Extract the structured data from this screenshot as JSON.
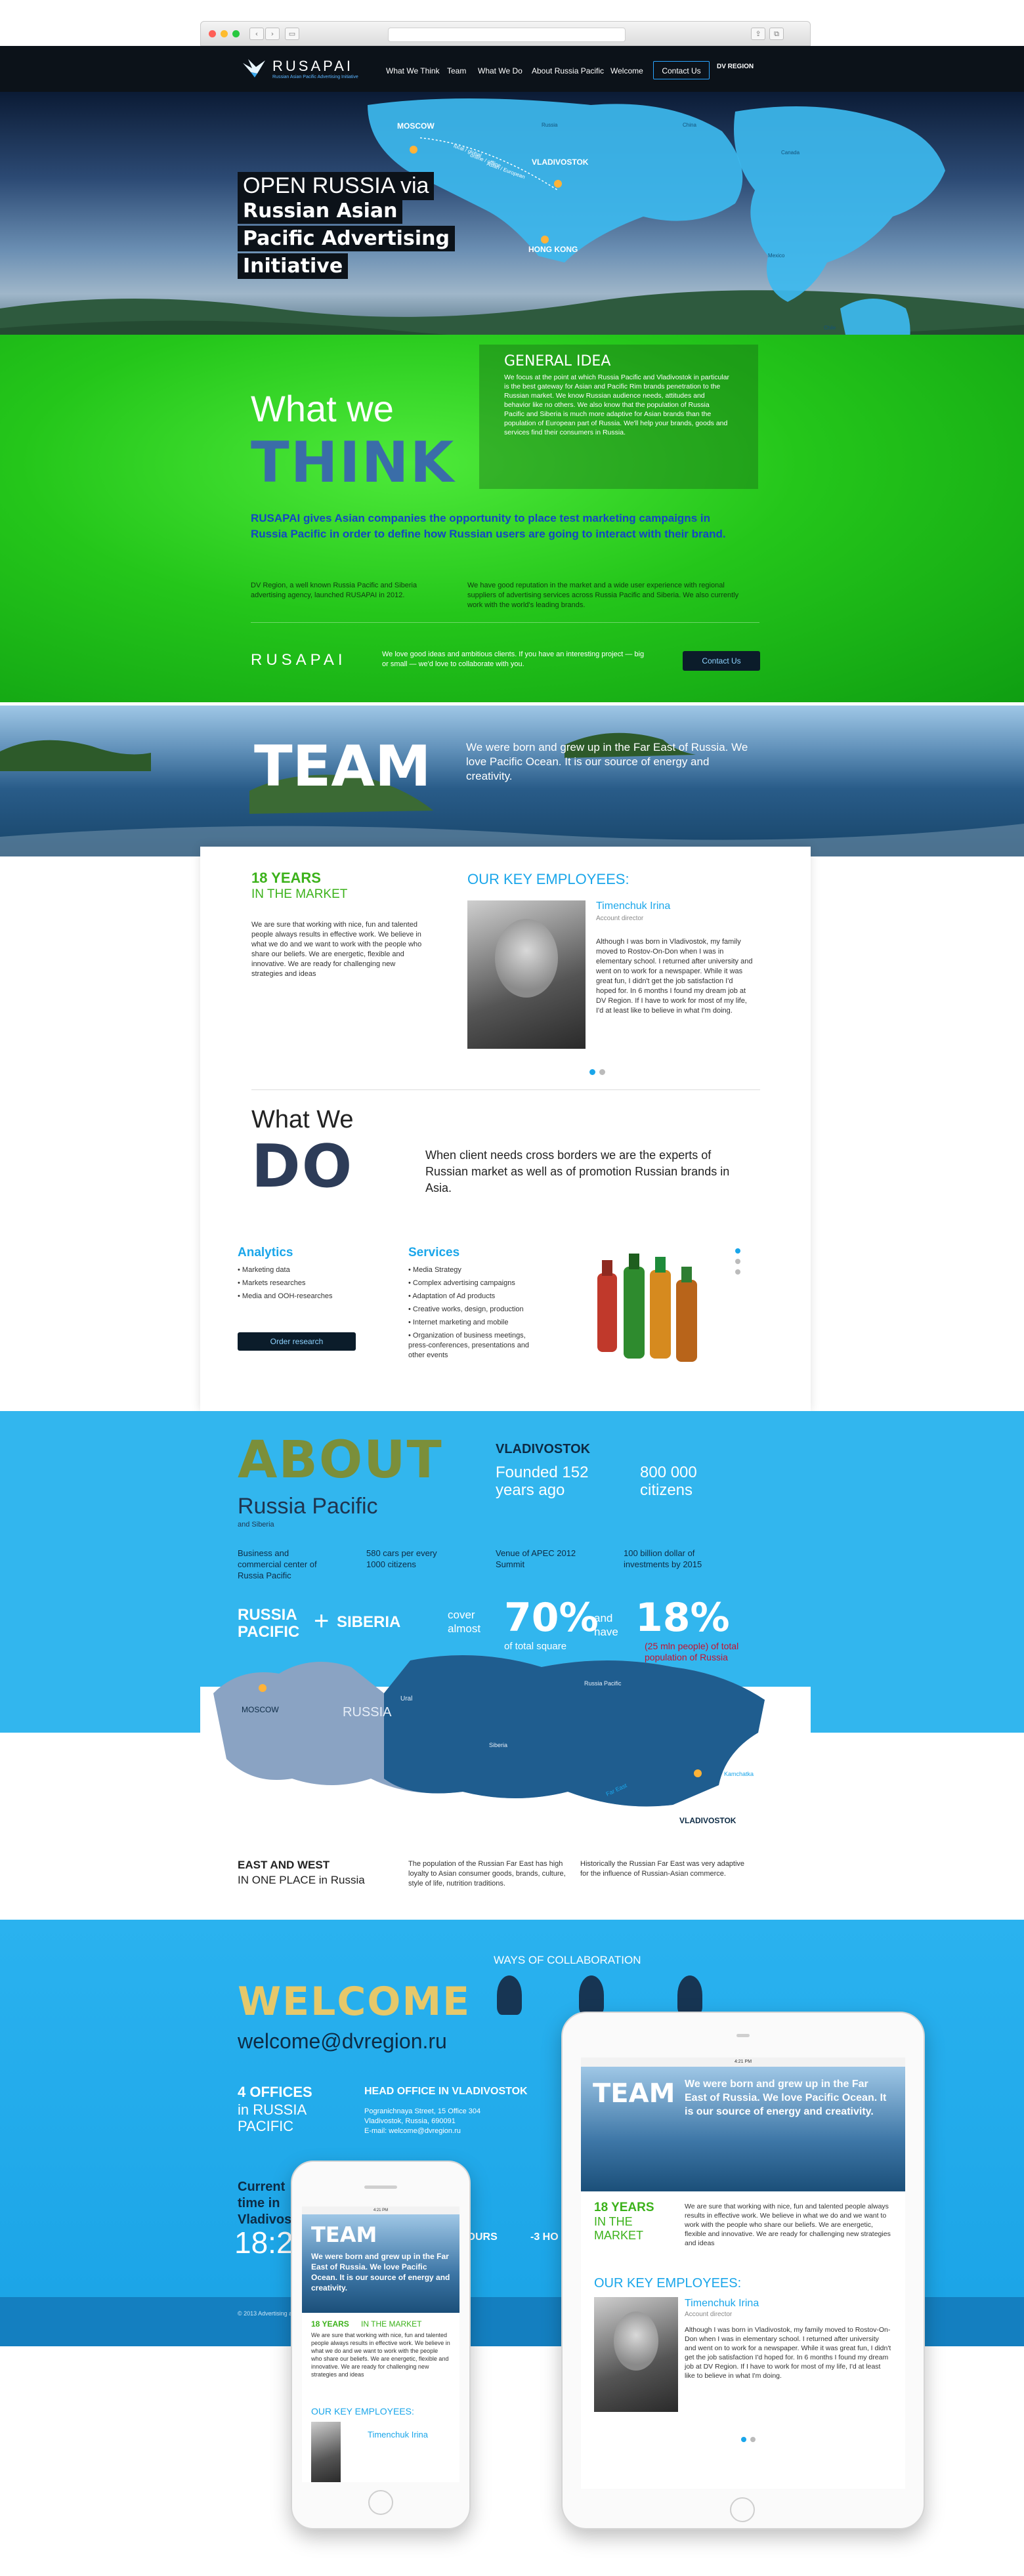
{
  "nav": {
    "logo": "RUSAPAI",
    "logo_sub": "Russian Asian Pacific Advertising Initiative",
    "items": [
      "What We Think",
      "Team",
      "What We Do",
      "About Russia Pacific",
      "Welcome"
    ],
    "contact": "Contact Us",
    "partner_logo": "DV REGION"
  },
  "hero": {
    "line1": "OPEN RUSSIA via",
    "line2": "Russian Asian",
    "line3": "Pacific Advertising",
    "line4": "Initiative",
    "cities": [
      "MOSCOW",
      "VLADIVOSTOK",
      "HONG KONG"
    ],
    "map_labels": [
      "Russia",
      "China",
      "Canada",
      "Mexico",
      "Chile"
    ],
    "route_labels": [
      "local / global",
      "online / offline",
      "Asian / European"
    ]
  },
  "think": {
    "what_we": "What we",
    "think": "THINK",
    "general_title": "GENERAL IDEA",
    "general_text": "We focus at the point at which Russia Pacific and Vladivostok in particular is the best gateway for Asian and Pacific Rim brands penetration to the Russian market. We know Russian audience needs, attitudes and behavior like no others. We also know that the population of Russia Pacific and Siberia is much more adaptive for Asian brands than the population of European part of Russia. We'll help your brands, goods and services find their consumers in Russia.",
    "lead": "RUSAPAI gives Asian companies the opportunity to place test marketing campaigns in Russia Pacific in order to define how Russian users are going to interact with their brand.",
    "col1": "DV Region, a well known Russia Pacific and Siberia advertising agency, launched RUSAPAI in 2012.",
    "col2": "We have good reputation in the market and a wide user experience with regional suppliers of advertising services across Russia Pacific and Siberia. We also currently work with the world's leading brands.",
    "band_logo": "RUSAPAI",
    "band_text": "We love good ideas and ambitious clients. If you have an interesting project — big or small — we'd love to collaborate with you.",
    "band_btn": "Contact Us"
  },
  "team": {
    "title": "TEAM",
    "tagline": "We were born and grew up in the Far East of Russia. We love Pacific Ocean. It is our source of energy and creativity.",
    "years_title": "18 YEARS",
    "years_sub": "IN THE MARKET",
    "years_text": "We are sure that working with nice, fun and talented people always results in effective work. We believe in what we do and we want to work with the people who share our beliefs. We are energetic, flexible and innovative. We are ready for challenging new strategies and ideas",
    "key_title": "OUR KEY EMPLOYEES:",
    "emp_name": "Timenchuk Irina",
    "emp_role": "Account director",
    "emp_text": "Although I was born in Vladivostok, my family moved to Rostov-On-Don when I was in elementary school. I returned after university and went on to work for a newspaper. While it was great fun, I didn't get the job satisfaction I'd hoped for. In 6 months I found my dream job at DV Region. If I have to work for most of my life, I'd at least like to believe in what I'm doing."
  },
  "do": {
    "what_we": "What We",
    "do": "DO",
    "lead": "When client needs cross borders we are the experts of Russian market as well as of promotion Russian brands in Asia.",
    "analytics_title": "Analytics",
    "analytics": [
      "Marketing data",
      "Markets researches",
      "Media and OOH-researches"
    ],
    "order_btn": "Order research",
    "services_title": "Services",
    "services": [
      "Media Strategy",
      "Complex advertising campaigns",
      "Adaptation of Ad products",
      "Creative works, design, production",
      "Internet marketing and mobile",
      "Organization of business meetings, press-conferences, presentations and other events"
    ]
  },
  "about": {
    "title": "ABOUT",
    "subtitle": "Russia Pacific",
    "subsub": "and Siberia",
    "city": "VLADIVOSTOK",
    "founded": "Founded 152 years ago",
    "citizens": "800 000 citizens",
    "facts": [
      "Business and commercial center of Russia Pacific",
      "580 cars per every 1000 citizens",
      "Venue of APEC 2012 Summit",
      "100 billion dollar of investments by 2015"
    ],
    "rp": "RUSSIA PACIFIC",
    "plus": "+",
    "siberia": "SIBERIA",
    "cover": "cover almost",
    "pct1": "70%",
    "pct1_label": "of total square",
    "and_have": "and have",
    "pct2": "18%",
    "pct2_label": "(25 mln people) of total population of Russia",
    "map_labels": [
      "MOSCOW",
      "RUSSIA",
      "Ural",
      "Siberia",
      "Russia Pacific",
      "Far East",
      "Kamchatka",
      "VLADIVOSTOK"
    ],
    "east_west_1": "EAST AND WEST",
    "east_west_2": "IN ONE PLACE in Russia",
    "col1": "The population of the Russian Far East has high loyalty to Asian consumer goods, brands, culture, style of life, nutrition traditions.",
    "col2": "Historically the Russian Far East was very adaptive for the influence of Russian-Asian commerce."
  },
  "welcome": {
    "title": "WELCOME",
    "email": "welcome@dvregion.ru",
    "ways": "WAYS OF COLLABORATION",
    "offices": "4 OFFICES",
    "offices_sub": "in RUSSIA PACIFIC",
    "head_title": "HEAD OFFICE IN VLADIVOSTOK",
    "head_addr1": "Pogranichnaya Street, 15 Office 304",
    "head_addr2": "Vladivostok, Russia, 690091",
    "head_email": "E-mail: welcome@dvregion.ru",
    "current": "Current time in Vladivostok",
    "time": "18:2",
    "hours": "HOURS",
    "hours2": "-3 HO",
    "footer": "© 2013 Advertising agency. Development and design"
  },
  "devices": {
    "tablet_status": "4:21 PM",
    "phone_status": "4:21 PM"
  },
  "colors": {
    "accent": "#1aa6ea",
    "green": "#3cb21b",
    "dark": "#0b1c2a"
  }
}
